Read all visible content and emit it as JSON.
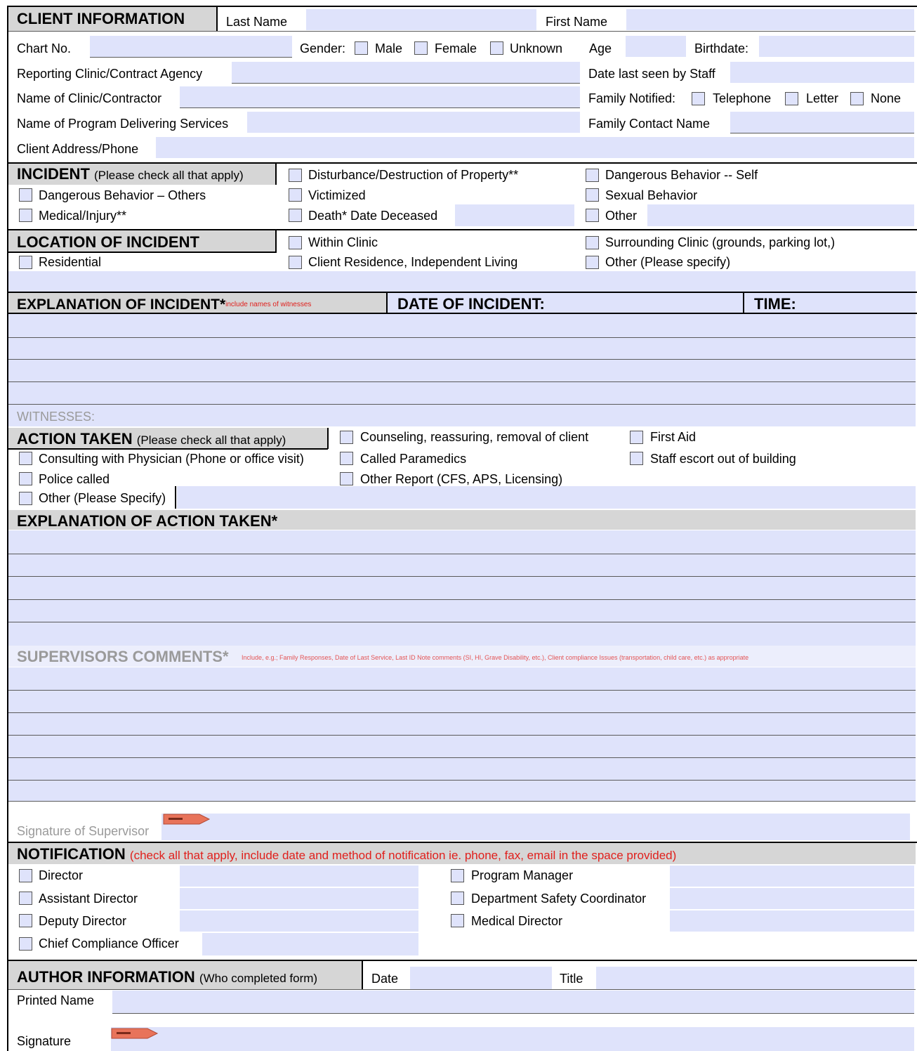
{
  "client_information": {
    "header": "CLIENT INFORMATION",
    "last_name_label": "Last Name",
    "first_name_label": "First Name",
    "chart_no_label": "Chart No.",
    "gender_label": "Gender:",
    "gender_options": [
      "Male",
      "Female",
      "Unknown"
    ],
    "age_label": "Age",
    "birthdate_label": "Birthdate:",
    "reporting_clinic_label": "Reporting Clinic/Contract Agency",
    "date_last_seen_label": "Date last seen by Staff",
    "name_of_clinic_label": "Name of Clinic/Contractor",
    "family_notified_label": "Family Notified:",
    "family_notified_options": [
      "Telephone",
      "Letter",
      "None"
    ],
    "program_label": "Name of Program Delivering Services",
    "family_contact_label": "Family Contact Name",
    "address_label": "Client Address/Phone"
  },
  "incident": {
    "header": "INCIDENT",
    "header_note": "(Please check all that apply)",
    "options": [
      "Disturbance/Destruction of Property**",
      "Dangerous Behavior -- Self",
      "Dangerous Behavior – Others",
      "Victimized",
      "Sexual Behavior",
      "Medical/Injury**",
      "Death* Date Deceased",
      "Other"
    ]
  },
  "location": {
    "header": "LOCATION OF INCIDENT",
    "options": [
      "Within Clinic",
      "Surrounding Clinic (grounds, parking lot,)",
      "Residential",
      "Client Residence, Independent Living",
      "Other (Please specify)"
    ]
  },
  "explanation": {
    "header": "EXPLANATION OF INCIDENT*",
    "note": "include names of witnesses",
    "date_label": "DATE OF INCIDENT:",
    "time_label": "TIME:",
    "witnesses_label": "WITNESSES:"
  },
  "action_taken": {
    "header": "ACTION TAKEN",
    "header_note": "(Please check all that apply)",
    "options": [
      "Counseling, reassuring, removal of client",
      "First Aid",
      "Consulting with Physician (Phone or office visit)",
      "Called Paramedics",
      "Staff escort out of building",
      "Police called",
      "Other Report (CFS, APS, Licensing)",
      "Other (Please Specify)"
    ]
  },
  "explanation_action": {
    "header": "EXPLANATION OF ACTION TAKEN*"
  },
  "supervisor": {
    "header": "SUPERVISORS COMMENTS*",
    "note": "Include, e.g.; Family Responses, Date of Last Service, Last ID Note comments (SI, HI, Grave Disability, etc.), Client compliance Issues (transportation, child care, etc.) as appropriate",
    "signature_label": "Signature of Supervisor"
  },
  "notification": {
    "header": "NOTIFICATION",
    "note": "(check all that apply, include date and method of notification ie. phone, fax, email in the space provided)",
    "left_options": [
      "Director",
      "Assistant Director",
      "Deputy Director",
      "Chief Compliance Officer"
    ],
    "right_options": [
      "Program Manager",
      "Department Safety Coordinator",
      "Medical Director"
    ]
  },
  "author": {
    "header": "AUTHOR INFORMATION",
    "header_note": "(Who completed form)",
    "date_label": "Date",
    "title_label": "Title",
    "printed_name_label": "Printed Name",
    "signature_label": "Signature"
  },
  "colors": {
    "field_fill": "#dfe3fb",
    "header_fill": "#d6d6d6",
    "note_red": "#e0201c",
    "sign_flag": "#e8735a"
  }
}
